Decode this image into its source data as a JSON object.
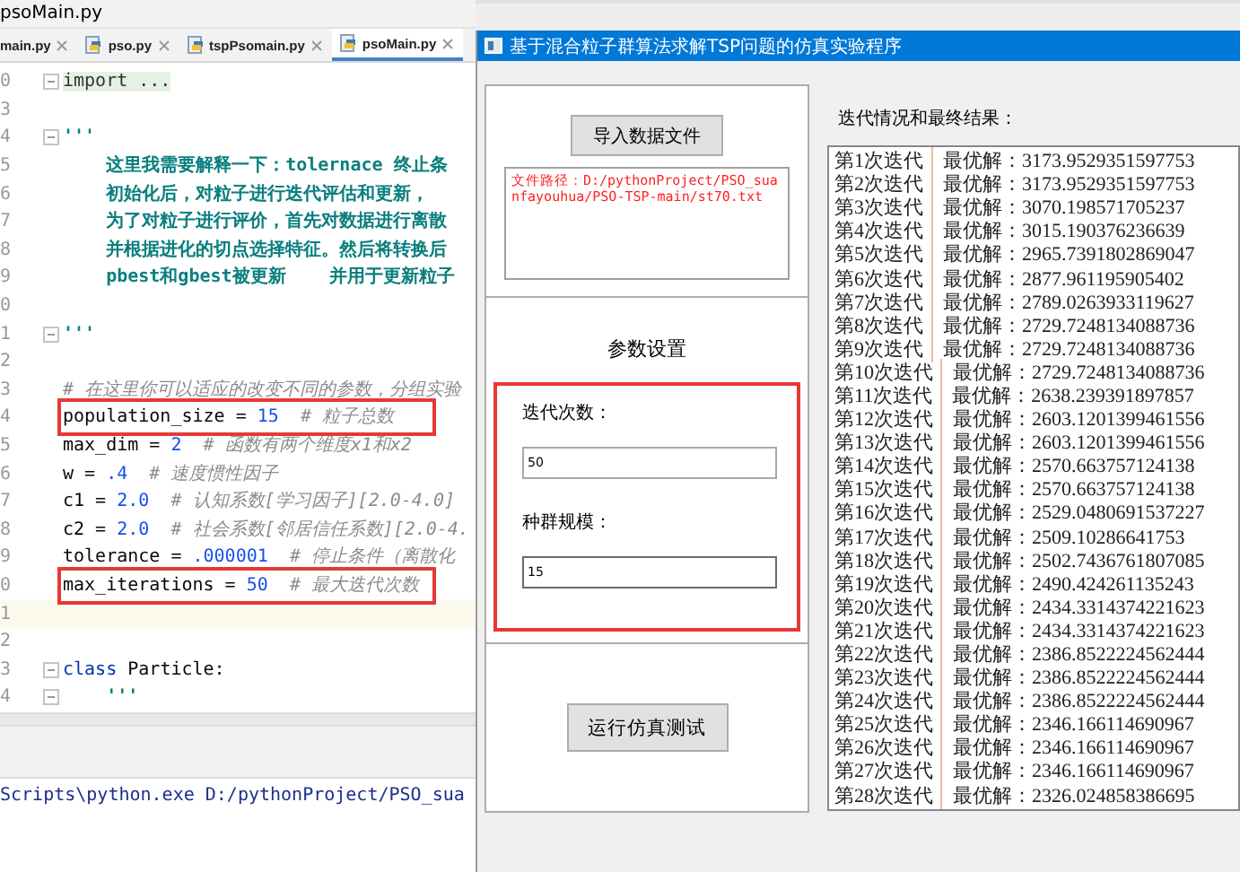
{
  "ide": {
    "title": "psoMain.py",
    "tabs": [
      {
        "label": "main.py",
        "selected": false,
        "show_icon": false
      },
      {
        "label": "pso.py",
        "selected": false,
        "show_icon": true
      },
      {
        "label": "tspPsomain.py",
        "selected": false,
        "show_icon": true
      },
      {
        "label": "psoMain.py",
        "selected": true,
        "show_icon": true
      }
    ],
    "code_lines": [
      {
        "number": "0",
        "fold_marker": true,
        "current": false,
        "annotated": false,
        "segments": [
          {
            "kind": "folded",
            "text": "import ..."
          }
        ]
      },
      {
        "number": "3",
        "fold_marker": false,
        "current": false,
        "annotated": false
      },
      {
        "number": "4",
        "fold_marker": true,
        "current": false,
        "annotated": false,
        "segments": [
          {
            "kind": "doc",
            "text": "'''"
          }
        ]
      },
      {
        "number": "5",
        "fold_marker": false,
        "current": false,
        "annotated": false,
        "segments": [
          {
            "kind": "doc",
            "text": "    这里我需要解释一下：tolernace 终止条"
          }
        ]
      },
      {
        "number": "6",
        "fold_marker": false,
        "current": false,
        "annotated": false,
        "segments": [
          {
            "kind": "doc",
            "text": "    初始化后，对粒子进行迭代评估和更新，"
          }
        ]
      },
      {
        "number": "7",
        "fold_marker": false,
        "current": false,
        "annotated": false,
        "segments": [
          {
            "kind": "doc",
            "text": "    为了对粒子进行评价，首先对数据进行离散"
          }
        ]
      },
      {
        "number": "8",
        "fold_marker": false,
        "current": false,
        "annotated": false,
        "segments": [
          {
            "kind": "doc",
            "text": "    并根据进化的切点选择特征。然后将转换后"
          }
        ]
      },
      {
        "number": "9",
        "fold_marker": false,
        "current": false,
        "annotated": false,
        "segments": [
          {
            "kind": "doc",
            "text": "    pbest和gbest被更新    并用于更新粒子"
          }
        ]
      },
      {
        "number": "0",
        "fold_marker": false,
        "current": false,
        "annotated": false
      },
      {
        "number": "1",
        "fold_marker": true,
        "current": false,
        "annotated": false,
        "segments": [
          {
            "kind": "doc",
            "text": "'''"
          }
        ]
      },
      {
        "number": "2",
        "fold_marker": false,
        "current": false,
        "annotated": false
      },
      {
        "number": "3",
        "fold_marker": false,
        "current": false,
        "annotated": false,
        "segments": [
          {
            "kind": "comment",
            "text": "# 在这里你可以适应的改变不同的参数，分组实验"
          }
        ]
      },
      {
        "number": "4",
        "fold_marker": false,
        "current": false,
        "annotated": true,
        "segments": [
          {
            "kind": "plain",
            "text": "population_size = "
          },
          {
            "kind": "number",
            "text": "15"
          },
          {
            "kind": "comment",
            "text": "  # 粒子总数"
          }
        ]
      },
      {
        "number": "5",
        "fold_marker": false,
        "current": false,
        "annotated": false,
        "segments": [
          {
            "kind": "plain",
            "text": "max_dim = "
          },
          {
            "kind": "number",
            "text": "2"
          },
          {
            "kind": "comment",
            "text": "  # 函数有两个维度x1和x2"
          }
        ]
      },
      {
        "number": "6",
        "fold_marker": false,
        "current": false,
        "annotated": false,
        "segments": [
          {
            "kind": "plain",
            "text": "w = "
          },
          {
            "kind": "number",
            "text": ".4"
          },
          {
            "kind": "comment",
            "text": "  # 速度惯性因子"
          }
        ]
      },
      {
        "number": "7",
        "fold_marker": false,
        "current": false,
        "annotated": false,
        "segments": [
          {
            "kind": "plain",
            "text": "c1 = "
          },
          {
            "kind": "number",
            "text": "2.0"
          },
          {
            "kind": "comment",
            "text": "  # 认知系数[学习因子][2.0-4.0]"
          }
        ]
      },
      {
        "number": "8",
        "fold_marker": false,
        "current": false,
        "annotated": false,
        "segments": [
          {
            "kind": "plain",
            "text": "c2 = "
          },
          {
            "kind": "number",
            "text": "2.0"
          },
          {
            "kind": "comment",
            "text": "  # 社会系数[邻居信任系数][2.0-4."
          }
        ]
      },
      {
        "number": "9",
        "fold_marker": false,
        "current": false,
        "annotated": false,
        "segments": [
          {
            "kind": "plain",
            "text": "tolerance = "
          },
          {
            "kind": "number",
            "text": ".000001"
          },
          {
            "kind": "comment",
            "text": "  # 停止条件（离散化"
          }
        ]
      },
      {
        "number": "0",
        "fold_marker": false,
        "current": false,
        "annotated": true,
        "segments": [
          {
            "kind": "plain",
            "text": "max_iterations = "
          },
          {
            "kind": "number",
            "text": "50"
          },
          {
            "kind": "comment",
            "text": "  # 最大迭代次数"
          }
        ]
      },
      {
        "number": "1",
        "fold_marker": false,
        "current": true,
        "annotated": false
      },
      {
        "number": "2",
        "fold_marker": false,
        "current": false,
        "annotated": false
      },
      {
        "number": "3",
        "fold_marker": true,
        "current": false,
        "annotated": false,
        "segments": [
          {
            "kind": "keyword",
            "text": "class"
          },
          {
            "kind": "plain",
            "text": " Particle:"
          }
        ]
      },
      {
        "number": "4",
        "fold_marker": true,
        "current": false,
        "annotated": false,
        "segments": [
          {
            "kind": "doc",
            "text": "    '''"
          }
        ]
      }
    ],
    "run_output": "Scripts\\python.exe D:/pythonProject/PSO_sua"
  },
  "app": {
    "title": "基于混合粒子群算法求解TSP问题的仿真实验程序",
    "import_button": "导入数据文件",
    "file_path": "文件路径：D:/pythonProject/PSO_suanfayouhua/PSO-TSP-main/st70.txt",
    "params_title": "参数设置",
    "params_annotated": true,
    "fields": [
      {
        "label": "迭代次数：",
        "value": "50"
      },
      {
        "label": "种群规模：",
        "value": "15"
      }
    ],
    "run_button": "运行仿真测试",
    "results_label": "迭代情况和最终结果：",
    "results": [
      {
        "iteration": "第1次迭代",
        "best": "最优解：3173.9529351597753"
      },
      {
        "iteration": "第2次迭代",
        "best": "最优解：3173.9529351597753"
      },
      {
        "iteration": "第3次迭代",
        "best": "最优解：3070.198571705237"
      },
      {
        "iteration": "第4次迭代",
        "best": "最优解：3015.190376236639"
      },
      {
        "iteration": "第5次迭代",
        "best": "最优解：2965.7391802869047"
      },
      {
        "iteration": "第6次迭代",
        "best": "最优解：2877.961195905402"
      },
      {
        "iteration": "第7次迭代",
        "best": "最优解：2789.0263933119627"
      },
      {
        "iteration": "第8次迭代",
        "best": "最优解：2729.7248134088736"
      },
      {
        "iteration": "第9次迭代",
        "best": "最优解：2729.7248134088736"
      },
      {
        "iteration": "第10次迭代",
        "best": "最优解：2729.7248134088736"
      },
      {
        "iteration": "第11次迭代",
        "best": "最优解：2638.239391897857"
      },
      {
        "iteration": "第12次迭代",
        "best": "最优解：2603.1201399461556"
      },
      {
        "iteration": "第13次迭代",
        "best": "最优解：2603.1201399461556"
      },
      {
        "iteration": "第14次迭代",
        "best": "最优解：2570.663757124138"
      },
      {
        "iteration": "第15次迭代",
        "best": "最优解：2570.663757124138"
      },
      {
        "iteration": "第16次迭代",
        "best": "最优解：2529.0480691537227"
      },
      {
        "iteration": "第17次迭代",
        "best": "最优解：2509.10286641753"
      },
      {
        "iteration": "第18次迭代",
        "best": "最优解：2502.7436761807085"
      },
      {
        "iteration": "第19次迭代",
        "best": "最优解：2490.424261135243"
      },
      {
        "iteration": "第20次迭代",
        "best": "最优解：2434.3314374221623"
      },
      {
        "iteration": "第21次迭代",
        "best": "最优解：2434.3314374221623"
      },
      {
        "iteration": "第22次迭代",
        "best": "最优解：2386.8522224562444"
      },
      {
        "iteration": "第23次迭代",
        "best": "最优解：2386.8522224562444"
      },
      {
        "iteration": "第24次迭代",
        "best": "最优解：2386.8522224562444"
      },
      {
        "iteration": "第25次迭代",
        "best": "最优解：2346.166114690967"
      },
      {
        "iteration": "第26次迭代",
        "best": "最优解：2346.166114690967"
      },
      {
        "iteration": "第27次迭代",
        "best": "最优解：2346.166114690967"
      },
      {
        "iteration": "第28次迭代",
        "best": "最优解：2326.024858386695"
      }
    ]
  }
}
